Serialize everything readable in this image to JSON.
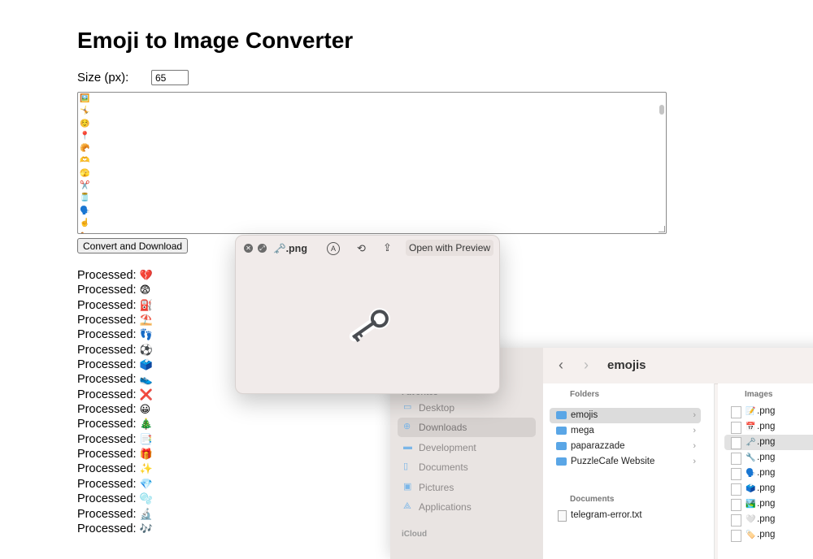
{
  "page": {
    "title": "Emoji to Image Converter",
    "size_label": "Size (px):",
    "size_value": "65",
    "textarea_lines": [
      "🖼️",
      "🤸",
      "☺️",
      "📍",
      "🥐",
      "🫶",
      "🫣",
      "✂️",
      "🫙",
      "🗣️",
      "☝️",
      "🐅"
    ],
    "convert_button": "Convert and Download",
    "processed_prefix": "Processed:",
    "processed_items": [
      "💔",
      "😨",
      "⛽",
      "⛱️",
      "👣",
      "⚽",
      "🗳️",
      "👟",
      "❌",
      "😀",
      "🎄",
      "📑",
      "🎁",
      "✨",
      "💎",
      "🫧",
      "🔬",
      "🎶"
    ]
  },
  "quicklook": {
    "file_icon": "🗝️",
    "filename": ".png",
    "open_with_label": "Open with Preview",
    "icons": [
      "close-icon",
      "fullscreen-icon",
      "markup-icon",
      "rotate-icon",
      "share-icon"
    ]
  },
  "finder": {
    "title": "emojis",
    "sidebar_favorites_label": "Favorites",
    "sidebar_items": [
      "Desktop",
      "Downloads",
      "Development",
      "Documents",
      "Pictures",
      "Applications"
    ],
    "sidebar_icloud_label": "iCloud",
    "folders_header": "Folders",
    "folders": [
      "emojis",
      "mega",
      "paparazzade",
      "PuzzleCafe Website"
    ],
    "documents_header": "Documents",
    "documents": [
      "telegram-error.txt"
    ],
    "images_header": "Images",
    "images": [
      {
        "emoji": "📝",
        "name": ".png"
      },
      {
        "emoji": "📅",
        "name": ".png"
      },
      {
        "emoji": "🗝️",
        "name": ".png"
      },
      {
        "emoji": "🔧",
        "name": ".png"
      },
      {
        "emoji": "🗣️",
        "name": ".png"
      },
      {
        "emoji": "🗳️",
        "name": ".png"
      },
      {
        "emoji": "🏞️",
        "name": ".png"
      },
      {
        "emoji": "🤍",
        "name": ".png"
      },
      {
        "emoji": "🏷️",
        "name": ".png"
      }
    ]
  }
}
